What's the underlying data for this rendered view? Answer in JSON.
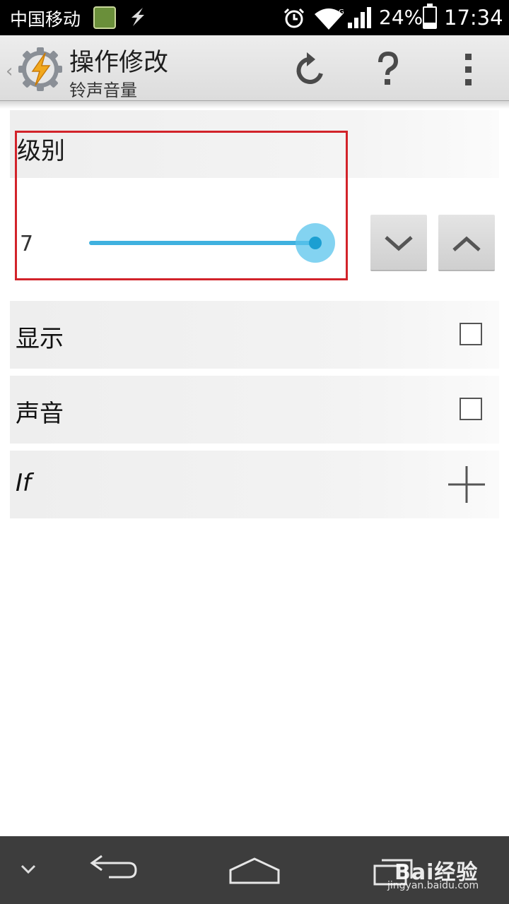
{
  "status_bar": {
    "carrier": "中国移动",
    "battery": "24%",
    "battery_level": 0.24,
    "time": "17:34",
    "icons": [
      "app-notification-icon",
      "usb-icon",
      "alarm-icon",
      "wifi-icon",
      "signal-icon",
      "battery-icon"
    ]
  },
  "action_bar": {
    "title": "操作修改",
    "subtitle": "铃声音量",
    "icons": [
      "back-icon",
      "app-logo",
      "undo-icon",
      "help-icon",
      "overflow-menu-icon"
    ]
  },
  "level": {
    "label": "级别",
    "value": "7",
    "slider_fraction": 1.0,
    "accent_color": "#3fb1df"
  },
  "options": [
    {
      "label": "显示",
      "checked": false
    },
    {
      "label": "声音",
      "checked": false
    }
  ],
  "condition": {
    "label": "If"
  },
  "highlight_color": "#d2232a",
  "watermark": {
    "brand": "Bai经验",
    "url": "jingyan.baidu.com"
  }
}
